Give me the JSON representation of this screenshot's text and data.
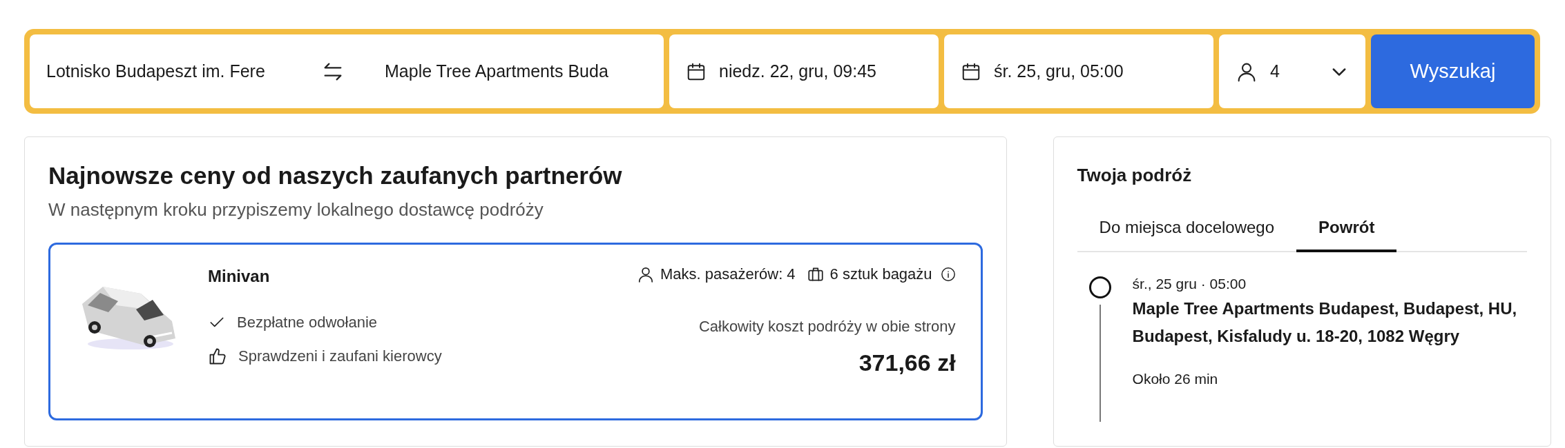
{
  "search_bar": {
    "from": "Lotnisko Budapeszt im. Fere",
    "to": "Maple Tree Apartments Buda",
    "outbound_date": "niedz. 22, gru, 09:45",
    "return_date": "śr. 25, gru, 05:00",
    "passengers": "4",
    "button": "Wyszukaj"
  },
  "offers": {
    "title": "Najnowsze ceny od naszych zaufanych partnerów",
    "subtitle": "W następnym kroku przypiszemy lokalnego dostawcę podróży",
    "items": [
      {
        "vehicle": "Minivan",
        "max_passengers": "Maks. pasażerów: 4",
        "luggage": "6 sztuk bagażu",
        "features": [
          {
            "kind": "check",
            "text": "Bezpłatne odwołanie"
          },
          {
            "kind": "thumb",
            "text": "Sprawdzeni i zaufani kierowcy"
          }
        ],
        "price_label": "Całkowity koszt podróży w obie strony",
        "price": "371,66 zł",
        "selected": true
      }
    ]
  },
  "trip": {
    "title": "Twoja podróż",
    "tabs": [
      {
        "label": "Do miejsca docelowego",
        "selected": false
      },
      {
        "label": "Powrót",
        "selected": true
      }
    ],
    "stops": [
      {
        "time": "śr., 25 gru · 05:00",
        "place": "Maple Tree Apartments Budapest, Budapest, HU, Budapest, Kisfaludy u. 18-20, 1082 Węgry",
        "duration": "Około 26 min"
      }
    ]
  }
}
